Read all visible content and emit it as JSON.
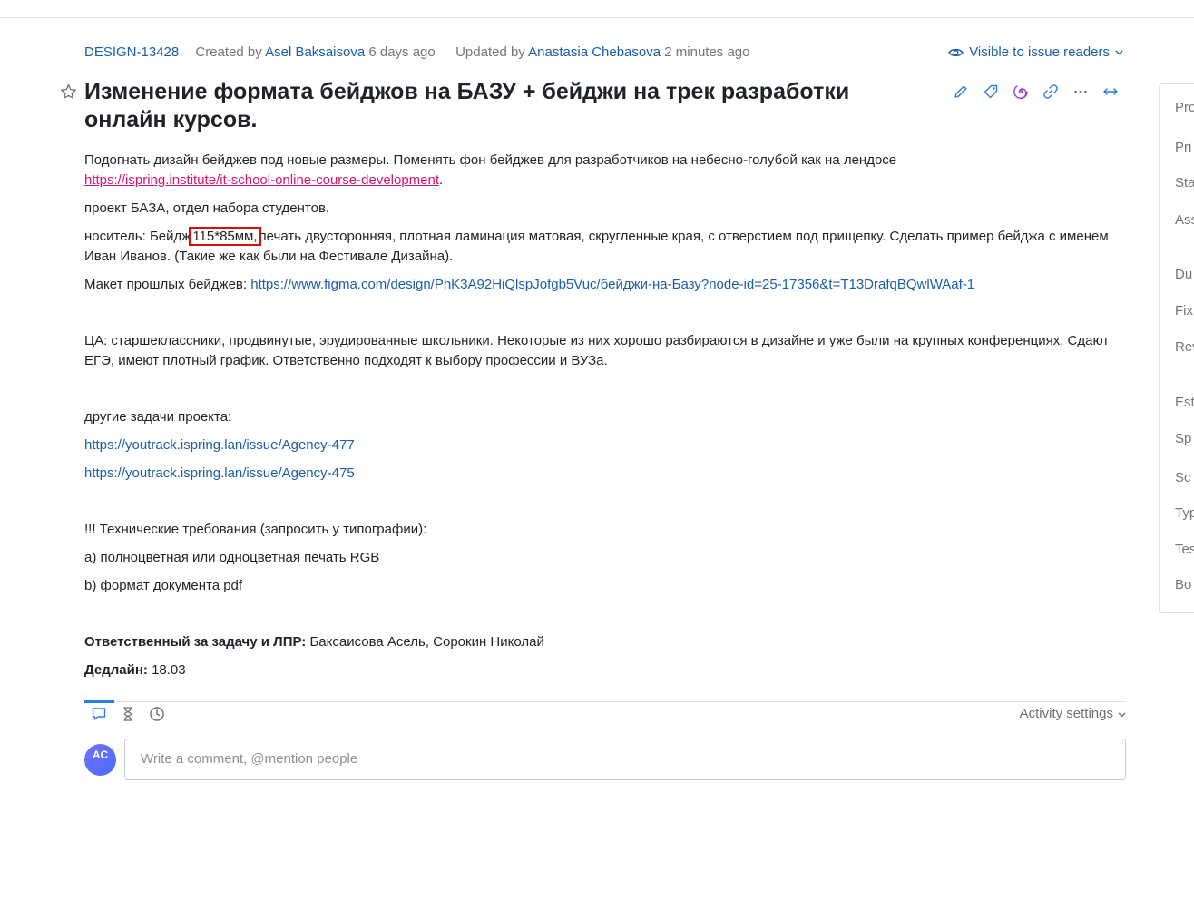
{
  "issue": {
    "id": "DESIGN-13428",
    "created_prefix": "Created by",
    "created_by": "Asel Baksaisova",
    "created_when": "6 days ago",
    "updated_prefix": "Updated by",
    "updated_by": "Anastasia Chebasova",
    "updated_when": "2 minutes ago",
    "visibility": "Visible to issue readers",
    "title": "Изменение формата бейджов на БАЗУ + бейджи на трек разработки онлайн курсов."
  },
  "toolbar": {
    "icons": [
      "pencil-icon",
      "tag-icon",
      "ai-swirl-icon",
      "link-icon",
      "more-icon",
      "expand-icon"
    ]
  },
  "description": {
    "p1_text": "Подогнать дизайн бейджев под новые размеры. Поменять фон бейджев для разработчиков на небесно-голубой как на лендосе",
    "p1_link": "https://ispring.institute/it-school-online-course-development",
    "p1_end": ".",
    "p2": "проект БАЗА, отдел набора студентов.",
    "p3_pre": "носитель: Бейдж",
    "p3_highlight": "115*85мм,",
    "p3_post": "печать двусторонняя, плотная ламинация матовая, скругленные края, с отверстием под прищепку. Сделать пример бейджа с именем Иван Иванов. (Такие же как были на Фестивале Дизайна).",
    "p4_pre": "Макет прошлых бейджев:",
    "p4_link": "https://www.figma.com/design/PhK3A92HiQlspJofgb5Vuc/бейджи-на-Базу?node-id=25-17356&t=T13DrafqBQwlWAaf-1",
    "p5": "ЦА: старшеклассники, продвинутые, эрудированные школьники. Некоторые из них хорошо разбираются в дизайне и уже были на крупных конференциях. Сдают ЕГЭ, имеют плотный график. Ответственно подходят к выбору профессии и ВУЗа.",
    "p6": "другие задачи проекта:",
    "link_a": "https://youtrack.ispring.lan/issue/Agency-477",
    "link_b": "https://youtrack.ispring.lan/issue/Agency-475",
    "p7": "!!! Технические требования (запросить у типографии):",
    "p8": "a) полноцветная или одноцветная печать RGB",
    "p9": "b) формат документа pdf",
    "resp_label": "Ответственный за задачу и ЛПР:",
    "resp_value": "Баксаисова Асель, Сорокин Николай",
    "deadline_label": "Дедлайн:",
    "deadline_value": "18.03"
  },
  "activity": {
    "settings_label": "Activity settings",
    "tabs": [
      "comments-icon",
      "hourglass-icon",
      "clock-icon"
    ]
  },
  "comment": {
    "avatar_initials": "AC",
    "placeholder": "Write a comment, @mention people"
  },
  "sidebar": {
    "labels": [
      "Pro",
      "Pri",
      "Sta",
      "Ass",
      "Du",
      "Fix",
      "Rev",
      "Est",
      "Sp",
      "Sc",
      "Typ",
      "Tes",
      "Bo"
    ]
  },
  "colors": {
    "link": "#1a5fa6",
    "pink_link": "#d6156c",
    "highlight_box": "#e10b0b",
    "accent": "#2a7de1"
  }
}
